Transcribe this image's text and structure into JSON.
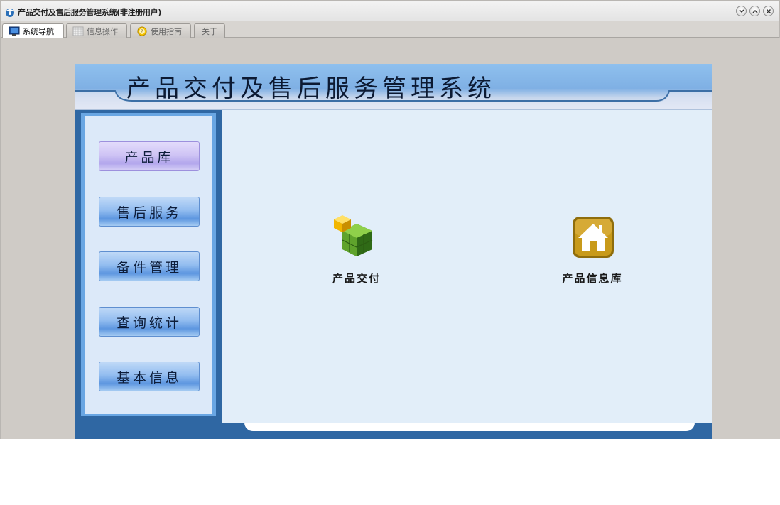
{
  "window": {
    "title": "产品交付及售后服务管理系统(非注册用户)",
    "controls": [
      "minimize",
      "restore",
      "close"
    ]
  },
  "tabs": [
    {
      "label": "系统导航",
      "icon": "monitor-icon",
      "active": true
    },
    {
      "label": "信息操作",
      "icon": "grid-icon",
      "active": false
    },
    {
      "label": "使用指南",
      "icon": "help-icon",
      "active": false
    },
    {
      "label": "关于",
      "icon": "",
      "active": false
    }
  ],
  "system": {
    "title": "产品交付及售后服务管理系统"
  },
  "sidebar": {
    "items": [
      {
        "label": "产品库",
        "active": true
      },
      {
        "label": "售后服务",
        "active": false
      },
      {
        "label": "备件管理",
        "active": false
      },
      {
        "label": "查询统计",
        "active": false
      },
      {
        "label": "基本信息",
        "active": false
      }
    ]
  },
  "main": {
    "functions": [
      {
        "label": "产品交付",
        "icon": "green-cubes-icon"
      },
      {
        "label": "产品信息库",
        "icon": "house-icon"
      }
    ]
  },
  "colors": {
    "header_top": "#8fc0ee",
    "panel_blue": "#2f67a3",
    "main_bg": "#e2eef9",
    "window_bg": "#cfcbc6"
  }
}
